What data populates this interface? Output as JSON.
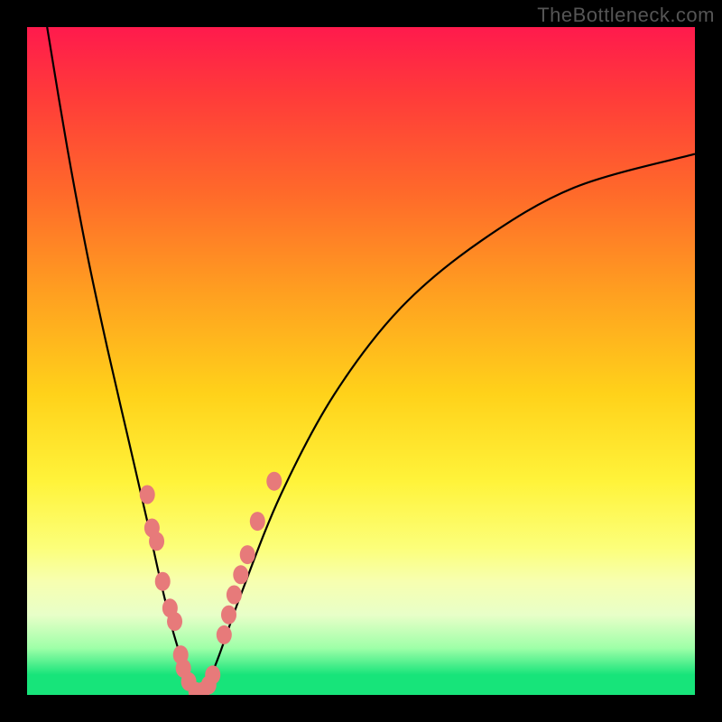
{
  "brand": {
    "watermark": "TheBottleneck.com"
  },
  "colors": {
    "gradient_top": "#ff1a4d",
    "gradient_mid": "#fff33a",
    "gradient_bottom": "#17e47a",
    "curve": "#000000",
    "marker_fill": "#e77a7a",
    "marker_stroke": "#d46a6a",
    "frame": "#000000"
  },
  "chart_data": {
    "type": "line",
    "title": "",
    "xlabel": "",
    "ylabel": "",
    "xlim": [
      0,
      100
    ],
    "ylim": [
      0,
      100
    ],
    "grid": false,
    "legend": false,
    "series": [
      {
        "name": "bottleneck-curve",
        "x": [
          3,
          6,
          9,
          12,
          15,
          18,
          20,
          22,
          24,
          25.5,
          28,
          32,
          38,
          46,
          56,
          68,
          82,
          100
        ],
        "y": [
          100,
          82,
          66,
          52,
          39,
          26,
          17,
          9,
          3,
          0,
          4,
          15,
          30,
          45,
          58,
          68,
          76,
          81
        ]
      }
    ],
    "markers": [
      {
        "x": 18.0,
        "y": 30
      },
      {
        "x": 18.7,
        "y": 25
      },
      {
        "x": 19.4,
        "y": 23
      },
      {
        "x": 20.3,
        "y": 17
      },
      {
        "x": 21.4,
        "y": 13
      },
      {
        "x": 22.1,
        "y": 11
      },
      {
        "x": 23.0,
        "y": 6
      },
      {
        "x": 23.4,
        "y": 4
      },
      {
        "x": 24.2,
        "y": 2
      },
      {
        "x": 25.3,
        "y": 0.5
      },
      {
        "x": 26.2,
        "y": 0.5
      },
      {
        "x": 27.2,
        "y": 1.5
      },
      {
        "x": 27.8,
        "y": 3
      },
      {
        "x": 29.5,
        "y": 9
      },
      {
        "x": 30.2,
        "y": 12
      },
      {
        "x": 31.0,
        "y": 15
      },
      {
        "x": 32.0,
        "y": 18
      },
      {
        "x": 33.0,
        "y": 21
      },
      {
        "x": 34.5,
        "y": 26
      },
      {
        "x": 37.0,
        "y": 32
      }
    ]
  }
}
